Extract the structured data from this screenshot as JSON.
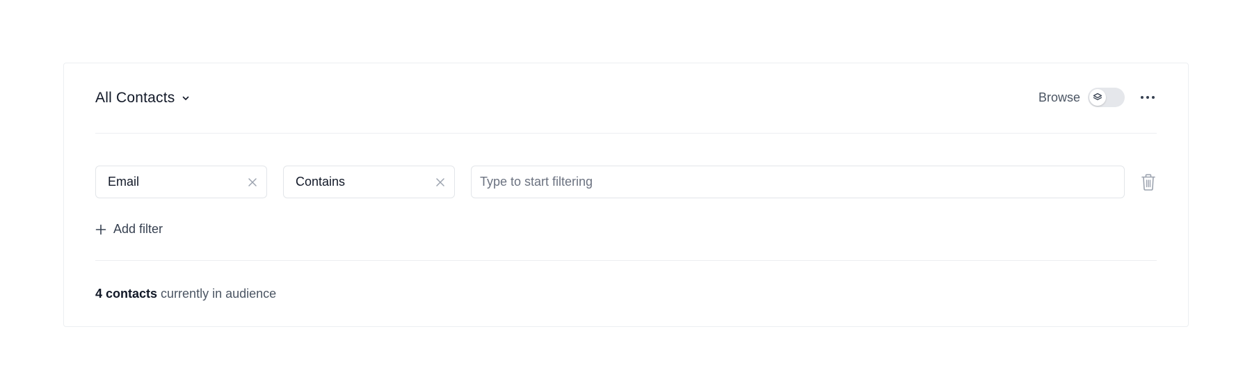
{
  "header": {
    "audience_title": "All Contacts",
    "browse_label": "Browse",
    "browse_toggle_on": false
  },
  "filter": {
    "field_value": "Email",
    "operator_value": "Contains",
    "value_placeholder": "Type to start filtering",
    "value": ""
  },
  "actions": {
    "add_filter_label": "Add filter"
  },
  "summary": {
    "count_text": "4 contacts",
    "suffix_text": " currently in audience"
  },
  "icons": {
    "audience_chevron": "chevron-down-icon",
    "browse_toggle": "layers-icon",
    "more": "more-horizontal-icon",
    "clear_field": "close-icon",
    "clear_operator": "close-icon",
    "delete_filter": "trash-icon",
    "add_filter": "plus-icon"
  },
  "colors": {
    "border": "#eceef1",
    "text_primary": "#111827",
    "text_secondary": "#4b5563",
    "toggle_track": "#e5e7eb"
  }
}
